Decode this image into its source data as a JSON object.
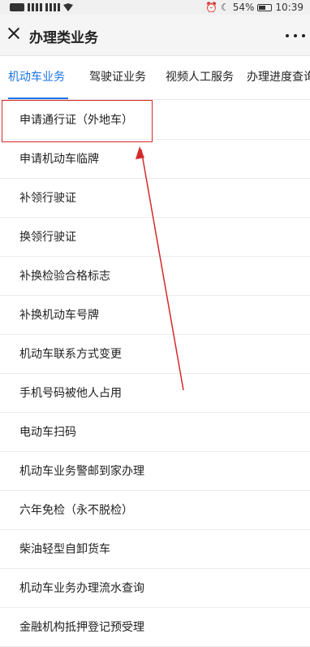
{
  "status_bar": {
    "battery_percent": "54%",
    "time": "10:39"
  },
  "header": {
    "title": "办理类业务"
  },
  "tabs": [
    {
      "label": "机动车业务",
      "active": true
    },
    {
      "label": "驾驶证业务",
      "active": false
    },
    {
      "label": "视频人工服务",
      "active": false
    },
    {
      "label": "办理进度查询",
      "active": false
    }
  ],
  "list_items": [
    {
      "label": "申请通行证（外地车）",
      "highlighted": true
    },
    {
      "label": "申请机动车临牌"
    },
    {
      "label": "补领行驶证"
    },
    {
      "label": "换领行驶证"
    },
    {
      "label": "补换检验合格标志"
    },
    {
      "label": "补换机动车号牌"
    },
    {
      "label": "机动车联系方式变更"
    },
    {
      "label": "手机号码被他人占用"
    },
    {
      "label": "电动车扫码"
    },
    {
      "label": "机动车业务警邮到家办理"
    },
    {
      "label": "六年免检（永不脱检）"
    },
    {
      "label": "柴油轻型自卸货车"
    },
    {
      "label": "机动车业务办理流水查询"
    },
    {
      "label": "金融机构抵押登记预受理"
    }
  ],
  "accent_color": "#1a73e8",
  "annotation_color": "#d42a2a"
}
